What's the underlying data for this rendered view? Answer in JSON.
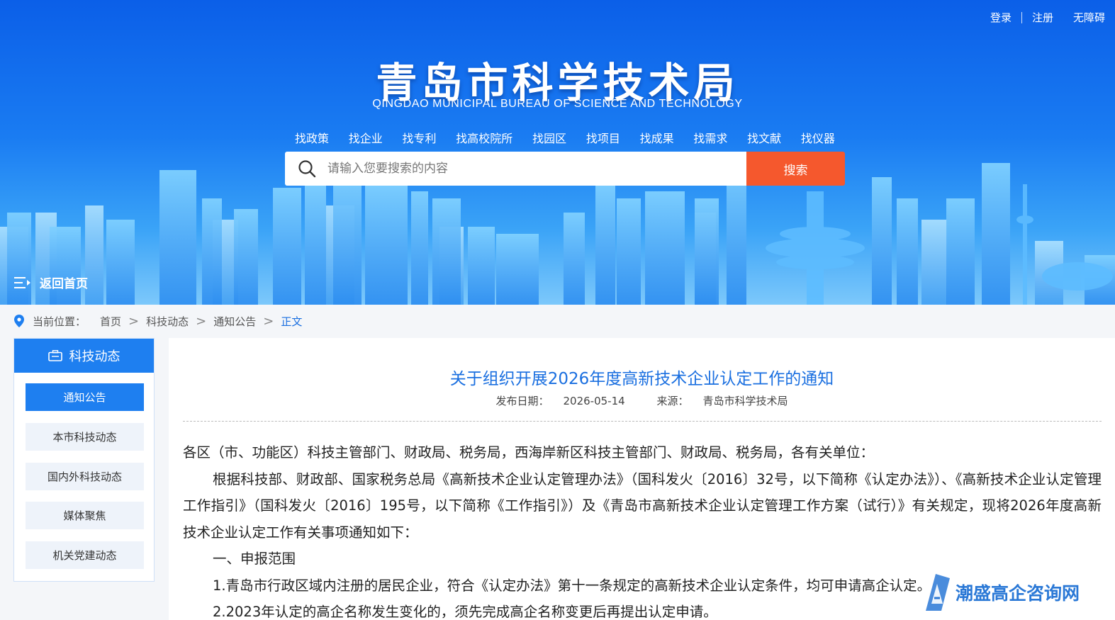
{
  "top_links": {
    "login": "登录",
    "register": "注册",
    "accessibility": "无障碍"
  },
  "site": {
    "title": "青岛市科学技术局",
    "subtitle": "QINGDAO MUNICIPAL BUREAU OF SCIENCE AND TECHNOLOGY"
  },
  "nav": [
    "找政策",
    "找企业",
    "找专利",
    "找高校院所",
    "找园区",
    "找项目",
    "找成果",
    "找需求",
    "找文献",
    "找仪器"
  ],
  "search": {
    "placeholder": "请输入您要搜索的内容",
    "button": "搜索"
  },
  "back_home": "返回首页",
  "breadcrumb": {
    "label": "当前位置：",
    "items": [
      "首页",
      "科技动态",
      "通知公告"
    ],
    "current": "正文"
  },
  "sidebar": {
    "title": "科技动态",
    "items": [
      "通知公告",
      "本市科技动态",
      "国内外科技动态",
      "媒体聚焦",
      "机关党建动态"
    ],
    "active_index": 0
  },
  "article": {
    "title": "关于组织开展2026年度高新技术企业认定工作的通知",
    "date_label": "发布日期：",
    "date": "2026-05-14",
    "source_label": "来源：",
    "source": "青岛市科学技术局",
    "paragraphs": [
      "各区（市、功能区）科技主管部门、财政局、税务局，西海岸新区科技主管部门、财政局、税务局，各有关单位：",
      "根据科技部、财政部、国家税务总局《高新技术企业认定管理办法》（国科发火〔2016〕32号，以下简称《认定办法》）、《高新技术企业认定管理工作指引》（国科发火〔2016〕195号，以下简称《工作指引》）及《青岛市高新技术企业认定管理工作方案（试行）》有关规定，现将2026年度高新技术企业认定工作有关事项通知如下：",
      "一、申报范围",
      "1.青岛市行政区域内注册的居民企业，符合《认定办法》第十一条规定的高新技术企业认定条件，均可申请高企认定。",
      "2.2023年认定的高企名称发生变化的，须先完成高企名称变更后再提出认定申请。"
    ]
  },
  "watermark": {
    "text": "潮盛高企咨询网"
  },
  "colors": {
    "accent": "#1e7ff0",
    "search_button": "#f5582d",
    "title_blue": "#1a6fe0"
  }
}
